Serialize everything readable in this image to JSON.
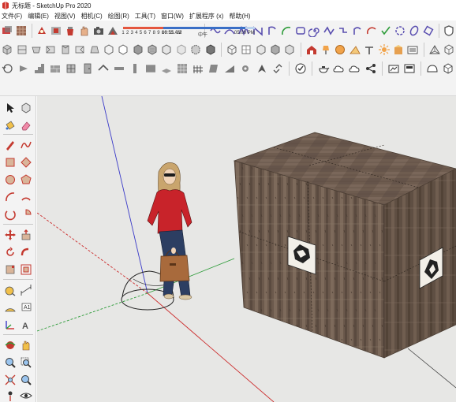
{
  "window": {
    "title": "无标题 - SketchUp Pro 2020"
  },
  "menubar": {
    "items": [
      "文件(F)",
      "编辑(E)",
      "视图(V)",
      "相机(C)",
      "绘图(R)",
      "工具(T)",
      "窗口(W)",
      "扩展程序 (x)",
      "帮助(H)"
    ]
  },
  "shadows": {
    "month_numbers": "1 2 3 4 5 6 7 8 9 10 11 12",
    "time_start": "06:55 AM",
    "time_mid": "中午",
    "time_end": "05:00 PM",
    "time_fill": 0.9
  },
  "colors": {
    "accent_red": "#d0322a",
    "sky": "#e7e7e5",
    "wood_dark": "#5a4a3e",
    "wood_mid": "#776658",
    "wood_light": "#8b7a6b",
    "axis_red": "#cc2b2b",
    "axis_green": "#2e9c3a",
    "axis_blue": "#3a3ac8"
  }
}
